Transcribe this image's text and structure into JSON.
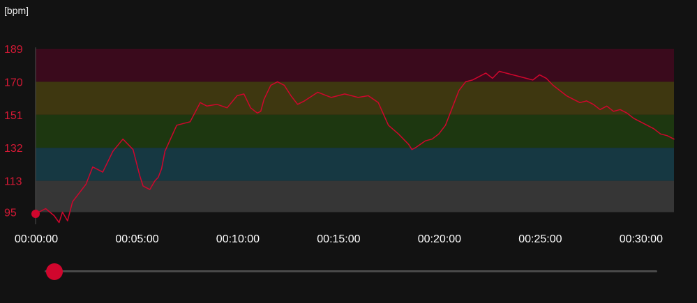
{
  "chart_data": {
    "type": "line",
    "unit_label": "[bpm]",
    "y_ticks": [
      "189",
      "170",
      "151",
      "132",
      "113",
      "95"
    ],
    "x_ticks": [
      "00:00:00",
      "00:05:00",
      "00:10:00",
      "00:15:00",
      "00:20:00",
      "00:25:00",
      "00:30:00"
    ],
    "x_range_seconds": [
      0,
      1900
    ],
    "ylim": [
      88,
      189
    ],
    "grid": false,
    "zones": [
      {
        "from": 170,
        "to": 189,
        "color": "#3a0a1c"
      },
      {
        "from": 151,
        "to": 170,
        "color": "#3e3710"
      },
      {
        "from": 132,
        "to": 151,
        "color": "#1d3710"
      },
      {
        "from": 113,
        "to": 132,
        "color": "#163842"
      },
      {
        "from": 95,
        "to": 113,
        "color": "#363636"
      }
    ],
    "series": [
      {
        "color": "#d0062d",
        "x_seconds": [
          0,
          30,
          55,
          70,
          80,
          95,
          110,
          150,
          170,
          200,
          230,
          260,
          290,
          310,
          320,
          340,
          355,
          365,
          375,
          385,
          420,
          460,
          490,
          510,
          540,
          570,
          600,
          620,
          640,
          660,
          670,
          680,
          700,
          720,
          740,
          760,
          780,
          800,
          840,
          880,
          920,
          960,
          990,
          1020,
          1050,
          1080,
          1110,
          1120,
          1130,
          1160,
          1180,
          1200,
          1220,
          1240,
          1260,
          1280,
          1300,
          1320,
          1340,
          1360,
          1380,
          1400,
          1420,
          1440,
          1460,
          1480,
          1500,
          1520,
          1540,
          1560,
          1580,
          1600,
          1620,
          1640,
          1660,
          1680,
          1700,
          1720,
          1740,
          1760,
          1780,
          1800,
          1820,
          1840,
          1860,
          1880,
          1900
        ],
        "values": [
          94,
          97,
          93,
          89,
          95,
          90,
          101,
          111,
          121,
          118,
          130,
          137,
          131,
          116,
          110,
          108,
          113,
          115,
          120,
          130,
          145,
          147,
          158,
          156,
          157,
          155,
          162,
          163,
          155,
          152,
          153,
          160,
          168,
          170,
          168,
          162,
          157,
          159,
          164,
          161,
          163,
          161,
          162,
          158,
          145,
          140,
          134,
          131,
          132,
          136,
          137,
          140,
          145,
          155,
          165,
          170,
          171,
          173,
          175,
          172,
          176,
          175,
          174,
          173,
          172,
          171,
          174,
          172,
          168,
          165,
          162,
          160,
          158,
          159,
          157,
          154,
          156,
          153,
          154,
          152,
          149,
          147,
          145,
          143,
          140,
          139,
          137
        ]
      }
    ]
  },
  "scrubber": {
    "position": 0.0
  }
}
